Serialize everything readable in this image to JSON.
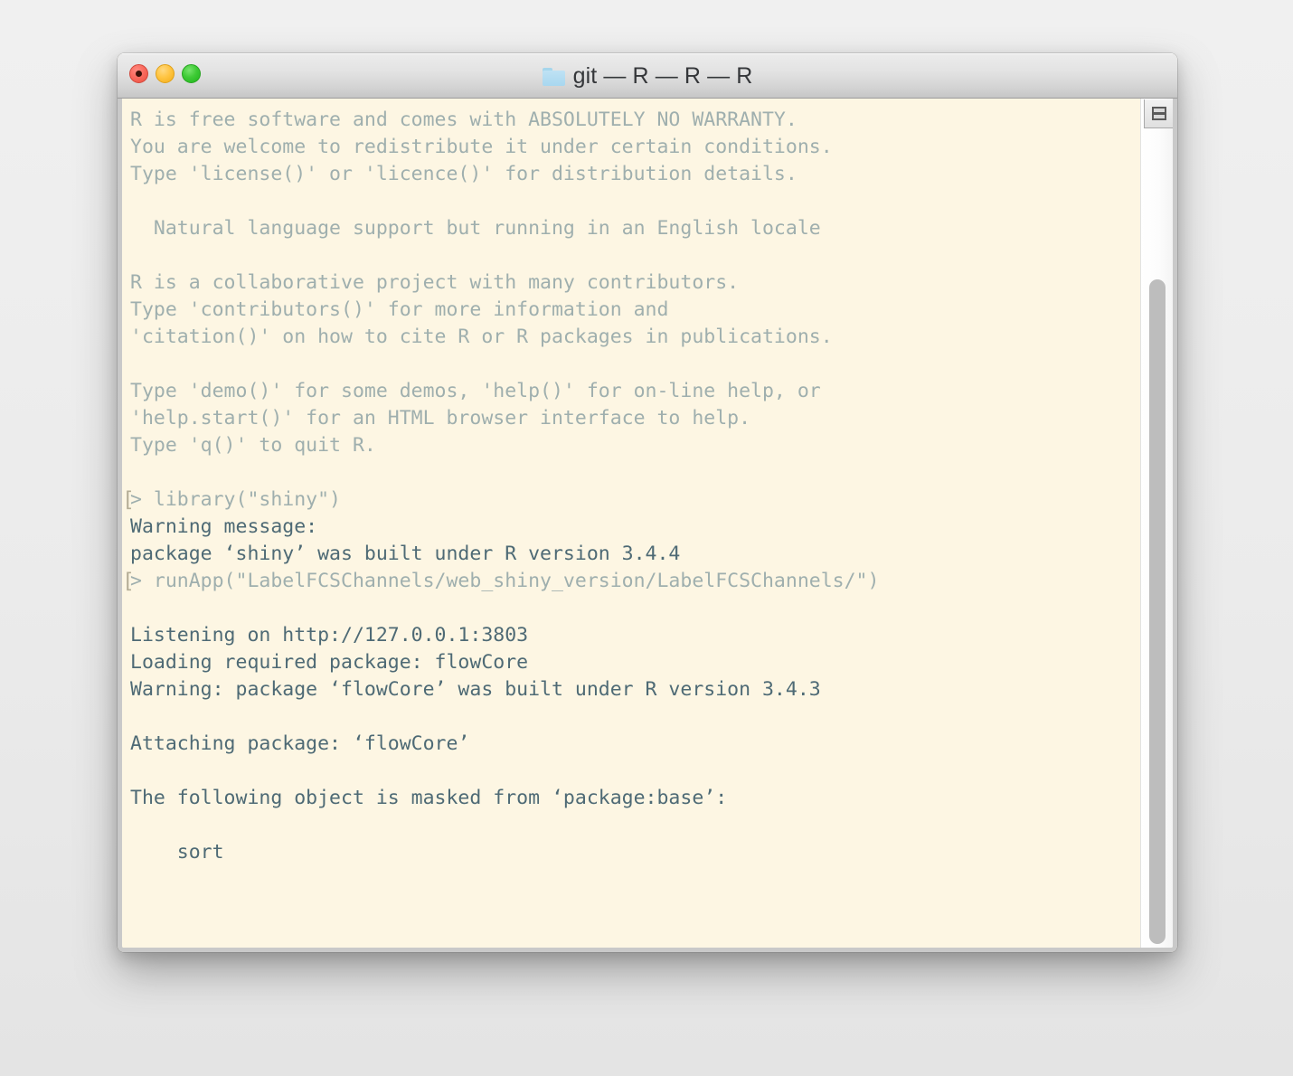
{
  "window": {
    "title": "git — R — R — R",
    "folder_icon": "folder-icon",
    "controls": {
      "close": "close-button",
      "minimize": "minimize-button",
      "zoom": "zoom-button"
    }
  },
  "scrollbar": {
    "split_pane_button": "split-pane-button"
  },
  "terminal": {
    "background_color": "#fdf6e3",
    "dim_text_color": "#9fafae",
    "text_color": "#4e6a75",
    "cursor_color": "#93a7a7",
    "prompt_bracket_open": "[",
    "prompt_bracket_close": "]",
    "lines": [
      {
        "text": "R is free software and comes with ABSOLUTELY NO WARRANTY.",
        "style": "dim"
      },
      {
        "text": "You are welcome to redistribute it under certain conditions.",
        "style": "dim"
      },
      {
        "text": "Type 'license()' or 'licence()' for distribution details.",
        "style": "dim"
      },
      {
        "text": "",
        "style": "blank"
      },
      {
        "text": "  Natural language support but running in an English locale",
        "style": "dim"
      },
      {
        "text": "",
        "style": "blank"
      },
      {
        "text": "R is a collaborative project with many contributors.",
        "style": "dim"
      },
      {
        "text": "Type 'contributors()' for more information and",
        "style": "dim"
      },
      {
        "text": "'citation()' on how to cite R or R packages in publications.",
        "style": "dim"
      },
      {
        "text": "",
        "style": "blank"
      },
      {
        "text": "Type 'demo()' for some demos, 'help()' for on-line help, or",
        "style": "dim"
      },
      {
        "text": "'help.start()' for an HTML browser interface to help.",
        "style": "dim"
      },
      {
        "text": "Type 'q()' to quit R.",
        "style": "dim"
      },
      {
        "text": "",
        "style": "blank"
      },
      {
        "text": "> library(\"shiny\")",
        "style": "cmd dim"
      },
      {
        "text": "Warning message:",
        "style": "normal"
      },
      {
        "text": "package ‘shiny’ was built under R version 3.4.4",
        "style": "normal"
      },
      {
        "text": "> runApp(\"LabelFCSChannels/web_shiny_version/LabelFCSChannels/\")",
        "style": "cmd dim"
      },
      {
        "text": "",
        "style": "blank"
      },
      {
        "text": "Listening on http://127.0.0.1:3803",
        "style": "normal"
      },
      {
        "text": "Loading required package: flowCore",
        "style": "normal"
      },
      {
        "text": "Warning: package ‘flowCore’ was built under R version 3.4.3",
        "style": "normal"
      },
      {
        "text": "",
        "style": "blank"
      },
      {
        "text": "Attaching package: ‘flowCore’",
        "style": "normal"
      },
      {
        "text": "",
        "style": "blank"
      },
      {
        "text": "The following object is masked from ‘package:base’:",
        "style": "normal"
      },
      {
        "text": "",
        "style": "blank"
      },
      {
        "text": "    sort",
        "style": "normal"
      }
    ]
  }
}
